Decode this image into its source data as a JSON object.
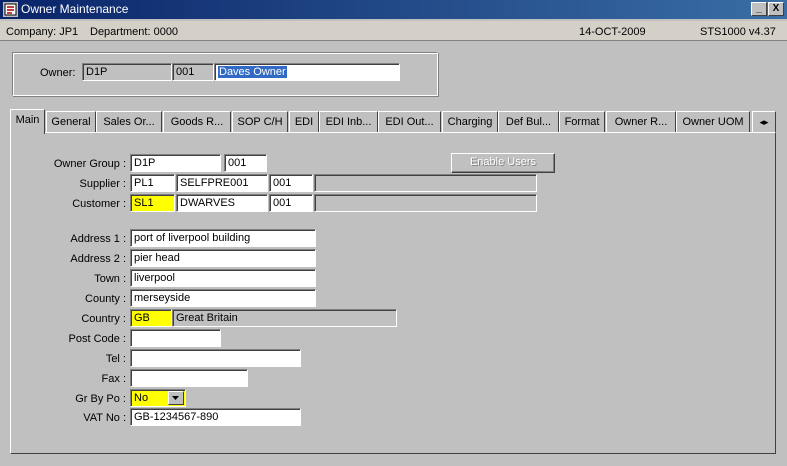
{
  "window": {
    "title": "Owner Maintenance",
    "minimize_glyph": "_",
    "close_glyph": "X"
  },
  "infobar": {
    "company": "Company:  JP1",
    "department": "Department:  0000",
    "date": "14-OCT-2009",
    "version": "STS1000  v4.37"
  },
  "owner_header": {
    "label": "Owner:",
    "code": "D1P",
    "number": "001",
    "name": "Daves Owner"
  },
  "tabs": [
    {
      "label": "Main",
      "active": true
    },
    {
      "label": "General"
    },
    {
      "label": "Sales Or..."
    },
    {
      "label": "Goods R..."
    },
    {
      "label": "SOP C/H"
    },
    {
      "label": "EDI"
    },
    {
      "label": "EDI Inb..."
    },
    {
      "label": "EDI Out..."
    },
    {
      "label": "Charging"
    },
    {
      "label": "Def Bul..."
    },
    {
      "label": "Format"
    },
    {
      "label": "Owner R..."
    },
    {
      "label": "Owner UOM"
    }
  ],
  "tab_scroll_glyphs": "◂▸",
  "main": {
    "enable_users_label": "Enable Users",
    "owner_group": {
      "label": "Owner Group :",
      "code": "D1P",
      "number": "001"
    },
    "supplier": {
      "label": "Supplier :",
      "code": "PL1",
      "name": "SELFPRE001",
      "number": "001",
      "desc": ""
    },
    "customer": {
      "label": "Customer :",
      "code": "SL1",
      "name": "DWARVES",
      "number": "001",
      "desc": ""
    },
    "address1": {
      "label": "Address 1 :",
      "value": "port of liverpool building"
    },
    "address2": {
      "label": "Address 2 :",
      "value": "pier head"
    },
    "town": {
      "label": "Town :",
      "value": "liverpool"
    },
    "county": {
      "label": "County :",
      "value": "merseyside"
    },
    "country": {
      "label": "Country :",
      "code": "GB",
      "name": "Great Britain"
    },
    "post_code": {
      "label": "Post Code :",
      "value": ""
    },
    "tel": {
      "label": "Tel :",
      "value": ""
    },
    "fax": {
      "label": "Fax :",
      "value": ""
    },
    "gr_by_po": {
      "label": "Gr By Po :",
      "value": "No"
    },
    "vat_no": {
      "label": "VAT No :",
      "value": "GB-1234567-890"
    }
  }
}
